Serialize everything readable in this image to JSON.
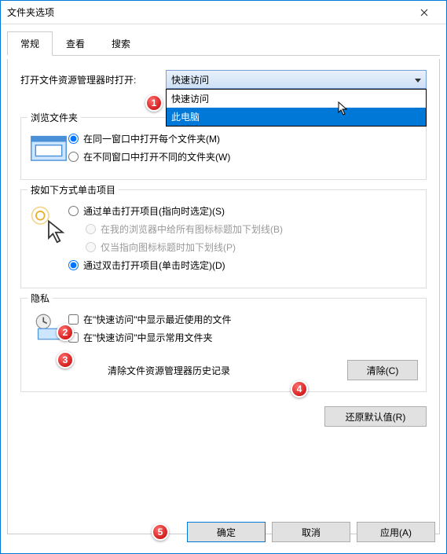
{
  "window": {
    "title": "文件夹选项"
  },
  "tabs": {
    "general": "常规",
    "view": "查看",
    "search": "搜索"
  },
  "open_label": "打开文件资源管理器时打开:",
  "combo": {
    "selected": "快速访问",
    "items": [
      "快速访问",
      "此电脑"
    ]
  },
  "browse": {
    "legend": "浏览文件夹",
    "same_window": "在同一窗口中打开每个文件夹(M)",
    "new_window": "在不同窗口中打开不同的文件夹(W)"
  },
  "click": {
    "legend": "按如下方式单击项目",
    "single": "通过单击打开项目(指向时选定)(S)",
    "underline_all": "在我的浏览器中给所有图标标题加下划线(B)",
    "underline_point": "仅当指向图标标题时加下划线(P)",
    "double": "通过双击打开项目(单击时选定)(D)"
  },
  "privacy": {
    "legend": "隐私",
    "recent_files": "在\"快速访问\"中显示最近使用的文件",
    "frequent_folders": "在\"快速访问\"中显示常用文件夹",
    "clear_label": "清除文件资源管理器历史记录",
    "clear_btn": "清除(C)"
  },
  "restore_defaults": "还原默认值(R)",
  "buttons": {
    "ok": "确定",
    "cancel": "取消",
    "apply": "应用(A)"
  },
  "markers": {
    "m1": "1",
    "m2": "2",
    "m3": "3",
    "m4": "4",
    "m5": "5"
  }
}
